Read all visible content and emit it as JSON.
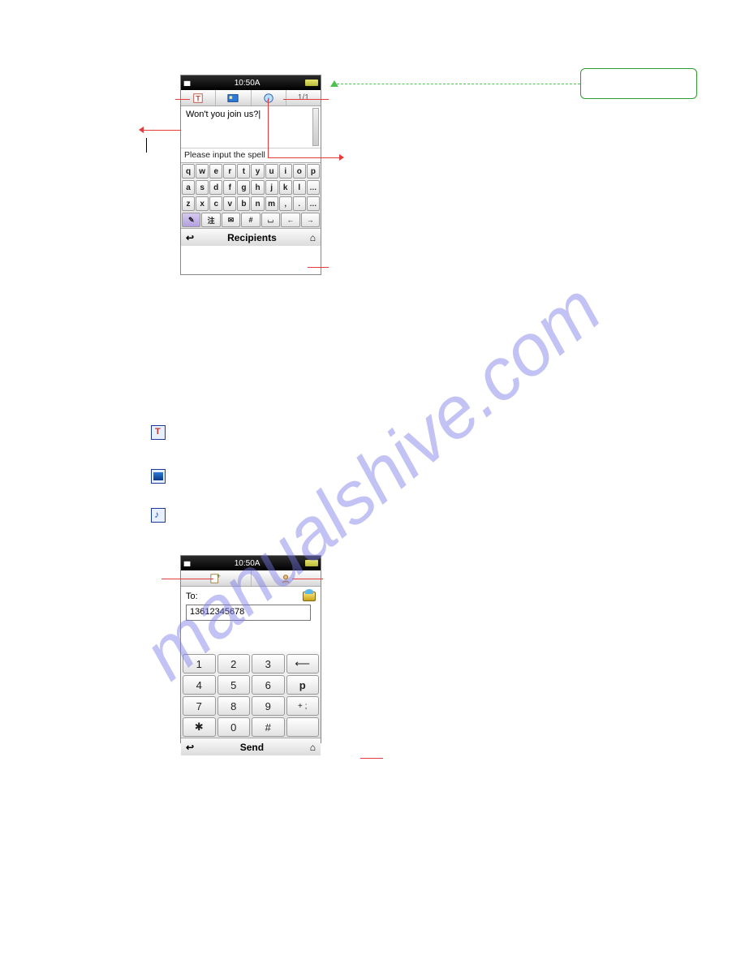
{
  "watermark": "manualshive.com",
  "phone1": {
    "status_time": "10:50A",
    "signal": "▮▮▮",
    "page_count": "1/1",
    "text_content": "Won't you join us?",
    "spell_hint": "Please input the spell",
    "keyboard": {
      "row1": [
        "q",
        "w",
        "e",
        "r",
        "t",
        "y",
        "u",
        "i",
        "o",
        "p"
      ],
      "row2": [
        "a",
        "s",
        "d",
        "f",
        "g",
        "h",
        "j",
        "k",
        "l",
        "…"
      ],
      "row3": [
        "z",
        "x",
        "c",
        "v",
        "b",
        "n",
        "m",
        ",",
        ".",
        "…"
      ],
      "row4": [
        "✎",
        "注",
        "✉",
        "#",
        "⌴",
        "←",
        "→"
      ]
    },
    "bottom_left": "↩",
    "bottom_label": "Recipients",
    "bottom_right": "⌂"
  },
  "inline_icons": {
    "text": "",
    "image": "",
    "sound": ""
  },
  "phone2": {
    "status_time": "10:50A",
    "to_label": "To:",
    "number": "13612345678",
    "keypad": {
      "r1": [
        "1",
        "2",
        "3",
        "⟵"
      ],
      "r2": [
        "4",
        "5",
        "6",
        "p"
      ],
      "r3": [
        "7",
        "8",
        "9",
        "+ ;"
      ],
      "r4": [
        "✱",
        "0",
        "#",
        ""
      ]
    },
    "bottom_left": "↩",
    "bottom_label": "Send",
    "bottom_right": "⌂"
  }
}
